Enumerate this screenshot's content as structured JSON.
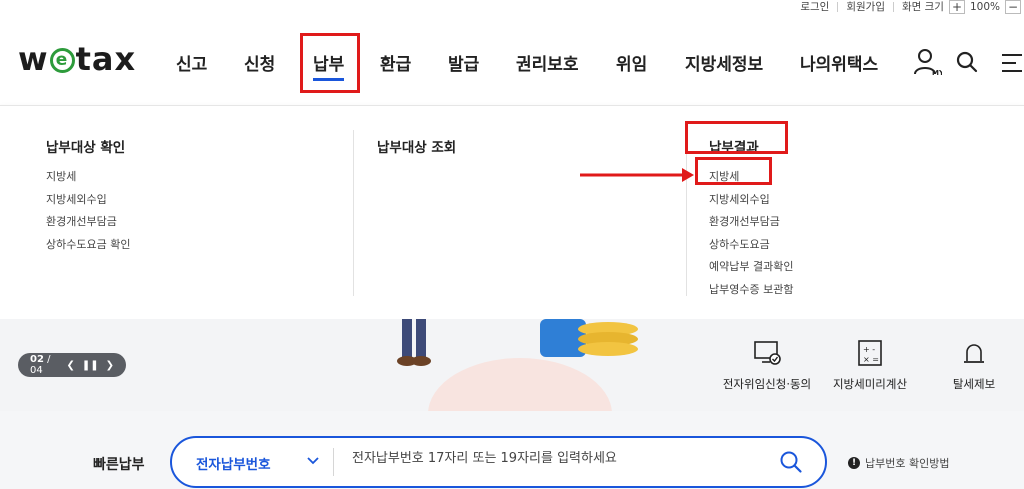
{
  "utility": {
    "logout": "로그인",
    "signup": "회원가입",
    "screen_size_label": "화면 크기",
    "zoom_in": "+",
    "zoom_level": "100%",
    "zoom_out": "−"
  },
  "logo": {
    "left": "w",
    "e": "e",
    "right": "tax"
  },
  "nav": [
    "신고",
    "신청",
    "납부",
    "환급",
    "발급",
    "권리보호",
    "위임",
    "지방세정보",
    "나의위택스"
  ],
  "nav_active": "납부",
  "header_icons": [
    "my-user-icon",
    "search-icon",
    "menu-icon"
  ],
  "my_badge": "MY",
  "menu": {
    "col1": {
      "title": "납부대상 확인",
      "items": [
        "지방세",
        "지방세외수입",
        "환경개선부담금",
        "상하수도요금 확인"
      ]
    },
    "col2": {
      "title": "납부대상 조회",
      "items": []
    },
    "col3": {
      "title": "납부결과",
      "items": [
        "지방세",
        "지방세외수입",
        "환경개선부담금",
        "상하수도요금",
        "예약납부 결과확인",
        "납부영수증 보관함"
      ]
    }
  },
  "slider": {
    "current": "02",
    "total": "04"
  },
  "quick_links": [
    "전자위임신청·동의",
    "지방세미리계산",
    "탈세제보"
  ],
  "quick_search": {
    "label": "빠른납부",
    "select_value": "전자납부번호",
    "placeholder": "전자납부번호 17자리 또는 19자리를 입력하세요",
    "help": "납부번호 확인방법"
  },
  "colors": {
    "accent": "#1a56db",
    "highlight": "#e01a1a",
    "logo_green": "#2d9b3b"
  }
}
